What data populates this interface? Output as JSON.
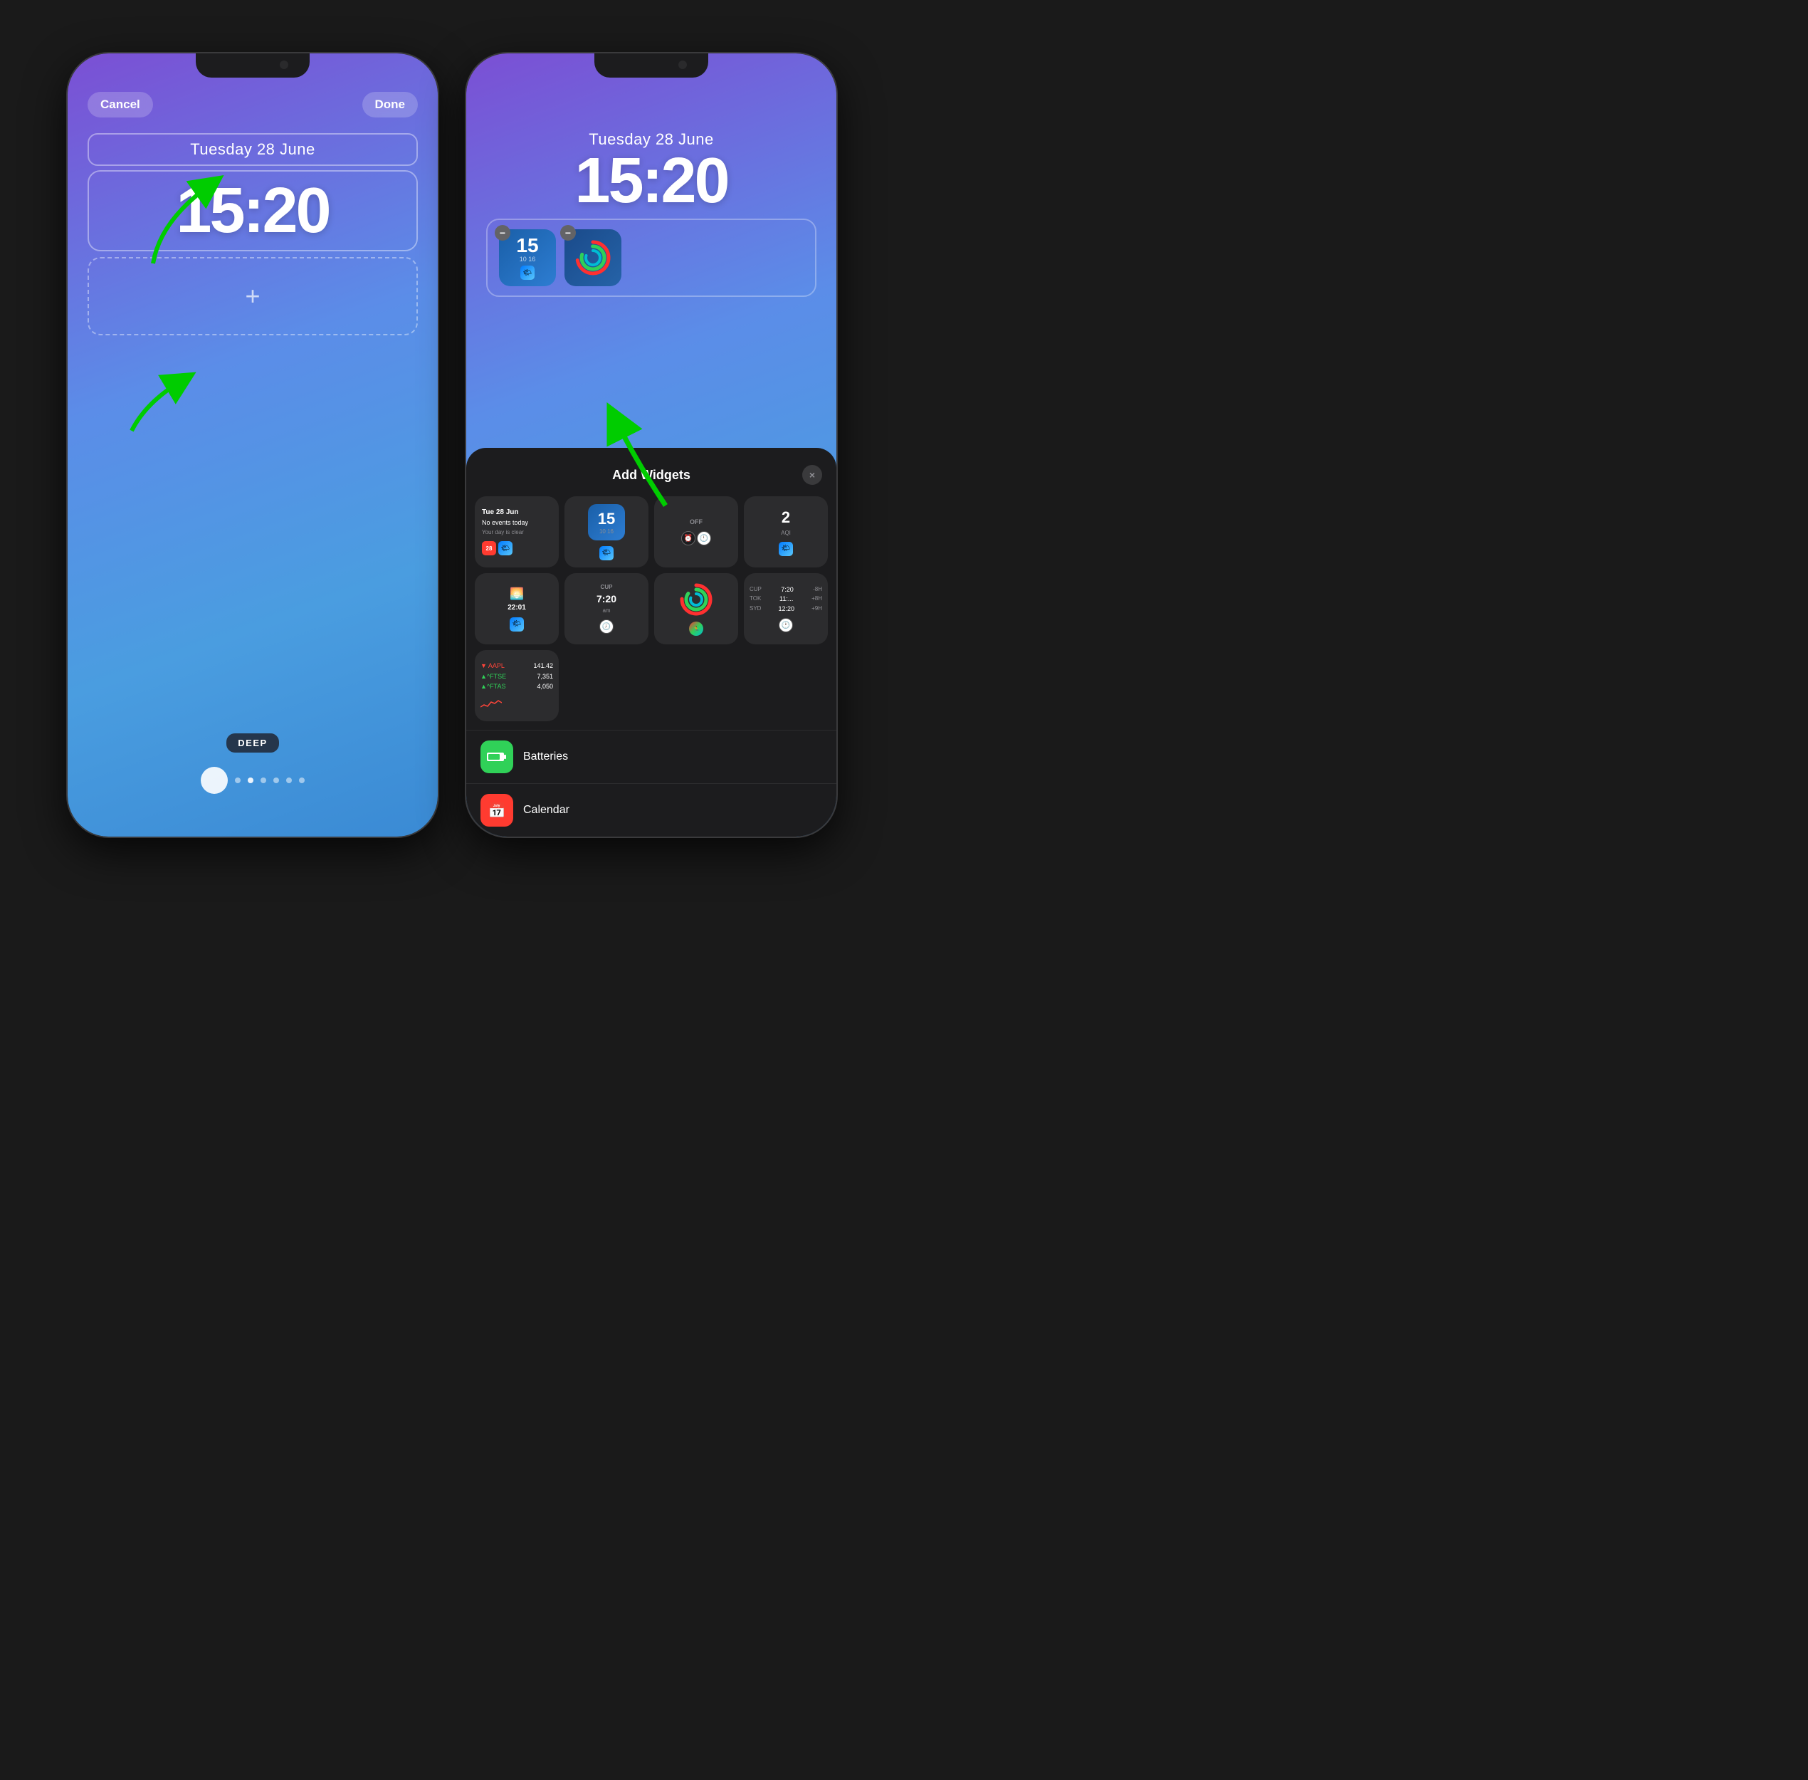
{
  "left_phone": {
    "header": {
      "cancel_label": "Cancel",
      "done_label": "Done"
    },
    "date_widget": {
      "text": "Tuesday 28 June"
    },
    "time_widget": {
      "text": "15:20"
    },
    "widget_placeholder": {
      "icon": "+"
    },
    "wallpaper_label": "DEEP",
    "dots": [
      {
        "active": true
      },
      {
        "active": false
      },
      {
        "active": false
      },
      {
        "active": false
      },
      {
        "active": false
      },
      {
        "active": false
      },
      {
        "active": false
      }
    ]
  },
  "right_phone": {
    "date_text": "Tuesday 28 June",
    "time_text": "15:20",
    "widgets": [
      {
        "type": "clock",
        "label": "15",
        "sub": "10 16"
      },
      {
        "type": "activity",
        "label": ""
      }
    ],
    "add_widgets_panel": {
      "title": "Add Widgets",
      "close_icon": "×",
      "widget_cards": [
        {
          "type": "calendar",
          "line1": "Tue 28 Jun",
          "line2": "No events today",
          "line3": "Your day is clear"
        },
        {
          "type": "clock_num",
          "num": "15",
          "sub": "10 16"
        },
        {
          "type": "alarm",
          "label": "OFF"
        },
        {
          "type": "aqi",
          "num": "2",
          "label": "AQI"
        },
        {
          "type": "sunrise",
          "time": "22:01"
        },
        {
          "type": "worldclock_cup",
          "label": "CUP",
          "time": "7:20",
          "ampm": "am"
        },
        {
          "type": "activity_rings"
        },
        {
          "type": "worldclock_stocks",
          "rows": [
            {
              "city": "CUP",
              "time": "7:20",
              "offset": "-8H"
            },
            {
              "city": "TOK",
              "time": "11:...",
              "offset": "+8H"
            },
            {
              "city": "SYD",
              "time": "12:20",
              "offset": "+9H"
            }
          ]
        },
        {
          "type": "stocks",
          "rows": [
            {
              "ticker": "▼ AAPL",
              "price": "141.42"
            },
            {
              "ticker": "▲^FTSE",
              "price": "7,351"
            },
            {
              "ticker": "▲^FTAS",
              "price": "4,050"
            }
          ]
        }
      ],
      "list_items": [
        {
          "label": "Batteries",
          "icon_color": "green",
          "icon": "battery"
        },
        {
          "label": "Calendar",
          "icon_color": "red",
          "icon": "calendar"
        }
      ]
    }
  }
}
